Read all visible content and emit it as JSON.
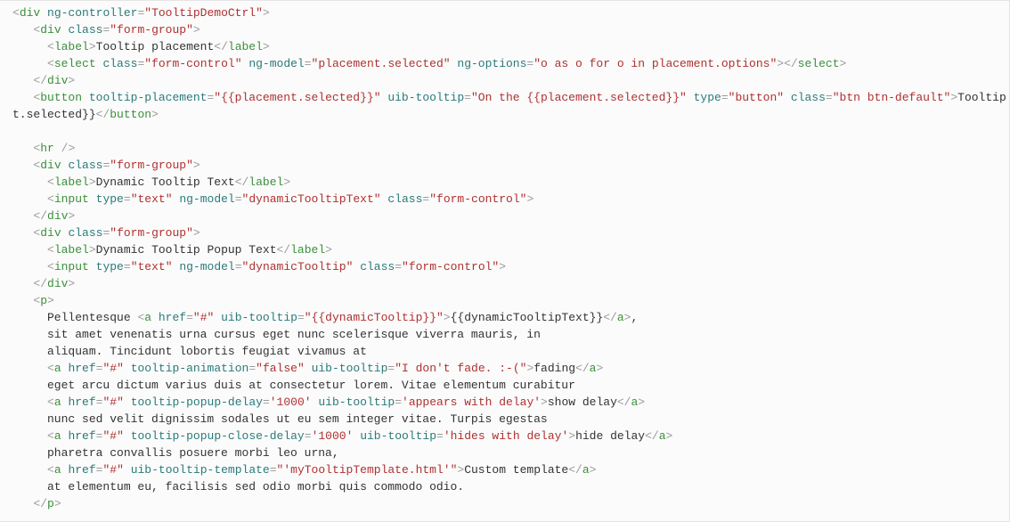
{
  "lines": [
    [
      [
        "p",
        "<"
      ],
      [
        "t",
        "div"
      ],
      [
        "x",
        " "
      ],
      [
        "a",
        "ng-controller"
      ],
      [
        "p",
        "="
      ],
      [
        "s",
        "\"TooltipDemoCtrl\""
      ],
      [
        "p",
        ">"
      ]
    ],
    [
      [
        "x",
        "   "
      ],
      [
        "p",
        "<"
      ],
      [
        "t",
        "div"
      ],
      [
        "x",
        " "
      ],
      [
        "a",
        "class"
      ],
      [
        "p",
        "="
      ],
      [
        "s",
        "\"form-group\""
      ],
      [
        "p",
        ">"
      ]
    ],
    [
      [
        "x",
        "     "
      ],
      [
        "p",
        "<"
      ],
      [
        "t",
        "label"
      ],
      [
        "p",
        ">"
      ],
      [
        "x",
        "Tooltip placement"
      ],
      [
        "p",
        "</"
      ],
      [
        "t",
        "label"
      ],
      [
        "p",
        ">"
      ]
    ],
    [
      [
        "x",
        "     "
      ],
      [
        "p",
        "<"
      ],
      [
        "t",
        "select"
      ],
      [
        "x",
        " "
      ],
      [
        "a",
        "class"
      ],
      [
        "p",
        "="
      ],
      [
        "s",
        "\"form-control\""
      ],
      [
        "x",
        " "
      ],
      [
        "a",
        "ng-model"
      ],
      [
        "p",
        "="
      ],
      [
        "s",
        "\"placement.selected\""
      ],
      [
        "x",
        " "
      ],
      [
        "a",
        "ng-options"
      ],
      [
        "p",
        "="
      ],
      [
        "s",
        "\"o as o for o in placement.options\""
      ],
      [
        "p",
        "></"
      ],
      [
        "t",
        "select"
      ],
      [
        "p",
        ">"
      ]
    ],
    [
      [
        "x",
        "   "
      ],
      [
        "p",
        "</"
      ],
      [
        "t",
        "div"
      ],
      [
        "p",
        ">"
      ]
    ],
    [
      [
        "x",
        "   "
      ],
      [
        "p",
        "<"
      ],
      [
        "t",
        "button"
      ],
      [
        "x",
        " "
      ],
      [
        "a",
        "tooltip-placement"
      ],
      [
        "p",
        "="
      ],
      [
        "s",
        "\"{{placement.selected}}\""
      ],
      [
        "x",
        " "
      ],
      [
        "a",
        "uib-tooltip"
      ],
      [
        "p",
        "="
      ],
      [
        "s",
        "\"On the {{placement.selected}}\""
      ],
      [
        "x",
        " "
      ],
      [
        "a",
        "type"
      ],
      [
        "p",
        "="
      ],
      [
        "s",
        "\"button\""
      ],
      [
        "x",
        " "
      ],
      [
        "a",
        "class"
      ],
      [
        "p",
        "="
      ],
      [
        "s",
        "\"btn btn-default\""
      ],
      [
        "p",
        ">"
      ],
      [
        "x",
        "Tooltip {{placemen"
      ]
    ],
    [
      [
        "x",
        "t.selected}}"
      ],
      [
        "p",
        "</"
      ],
      [
        "t",
        "button"
      ],
      [
        "p",
        ">"
      ]
    ],
    [
      [
        "x",
        " "
      ]
    ],
    [
      [
        "x",
        "   "
      ],
      [
        "p",
        "<"
      ],
      [
        "t",
        "hr"
      ],
      [
        "x",
        " "
      ],
      [
        "p",
        "/>"
      ]
    ],
    [
      [
        "x",
        "   "
      ],
      [
        "p",
        "<"
      ],
      [
        "t",
        "div"
      ],
      [
        "x",
        " "
      ],
      [
        "a",
        "class"
      ],
      [
        "p",
        "="
      ],
      [
        "s",
        "\"form-group\""
      ],
      [
        "p",
        ">"
      ]
    ],
    [
      [
        "x",
        "     "
      ],
      [
        "p",
        "<"
      ],
      [
        "t",
        "label"
      ],
      [
        "p",
        ">"
      ],
      [
        "x",
        "Dynamic Tooltip Text"
      ],
      [
        "p",
        "</"
      ],
      [
        "t",
        "label"
      ],
      [
        "p",
        ">"
      ]
    ],
    [
      [
        "x",
        "     "
      ],
      [
        "p",
        "<"
      ],
      [
        "t",
        "input"
      ],
      [
        "x",
        " "
      ],
      [
        "a",
        "type"
      ],
      [
        "p",
        "="
      ],
      [
        "s",
        "\"text\""
      ],
      [
        "x",
        " "
      ],
      [
        "a",
        "ng-model"
      ],
      [
        "p",
        "="
      ],
      [
        "s",
        "\"dynamicTooltipText\""
      ],
      [
        "x",
        " "
      ],
      [
        "a",
        "class"
      ],
      [
        "p",
        "="
      ],
      [
        "s",
        "\"form-control\""
      ],
      [
        "p",
        ">"
      ]
    ],
    [
      [
        "x",
        "   "
      ],
      [
        "p",
        "</"
      ],
      [
        "t",
        "div"
      ],
      [
        "p",
        ">"
      ]
    ],
    [
      [
        "x",
        "   "
      ],
      [
        "p",
        "<"
      ],
      [
        "t",
        "div"
      ],
      [
        "x",
        " "
      ],
      [
        "a",
        "class"
      ],
      [
        "p",
        "="
      ],
      [
        "s",
        "\"form-group\""
      ],
      [
        "p",
        ">"
      ]
    ],
    [
      [
        "x",
        "     "
      ],
      [
        "p",
        "<"
      ],
      [
        "t",
        "label"
      ],
      [
        "p",
        ">"
      ],
      [
        "x",
        "Dynamic Tooltip Popup Text"
      ],
      [
        "p",
        "</"
      ],
      [
        "t",
        "label"
      ],
      [
        "p",
        ">"
      ]
    ],
    [
      [
        "x",
        "     "
      ],
      [
        "p",
        "<"
      ],
      [
        "t",
        "input"
      ],
      [
        "x",
        " "
      ],
      [
        "a",
        "type"
      ],
      [
        "p",
        "="
      ],
      [
        "s",
        "\"text\""
      ],
      [
        "x",
        " "
      ],
      [
        "a",
        "ng-model"
      ],
      [
        "p",
        "="
      ],
      [
        "s",
        "\"dynamicTooltip\""
      ],
      [
        "x",
        " "
      ],
      [
        "a",
        "class"
      ],
      [
        "p",
        "="
      ],
      [
        "s",
        "\"form-control\""
      ],
      [
        "p",
        ">"
      ]
    ],
    [
      [
        "x",
        "   "
      ],
      [
        "p",
        "</"
      ],
      [
        "t",
        "div"
      ],
      [
        "p",
        ">"
      ]
    ],
    [
      [
        "x",
        "   "
      ],
      [
        "p",
        "<"
      ],
      [
        "t",
        "p"
      ],
      [
        "p",
        ">"
      ]
    ],
    [
      [
        "x",
        "     Pellentesque "
      ],
      [
        "p",
        "<"
      ],
      [
        "t",
        "a"
      ],
      [
        "x",
        " "
      ],
      [
        "a",
        "href"
      ],
      [
        "p",
        "="
      ],
      [
        "s",
        "\"#\""
      ],
      [
        "x",
        " "
      ],
      [
        "a",
        "uib-tooltip"
      ],
      [
        "p",
        "="
      ],
      [
        "s",
        "\"{{dynamicTooltip}}\""
      ],
      [
        "p",
        ">"
      ],
      [
        "x",
        "{{dynamicTooltipText}}"
      ],
      [
        "p",
        "</"
      ],
      [
        "t",
        "a"
      ],
      [
        "p",
        ">"
      ],
      [
        "x",
        ","
      ]
    ],
    [
      [
        "x",
        "     sit amet venenatis urna cursus eget nunc scelerisque viverra mauris, in"
      ]
    ],
    [
      [
        "x",
        "     aliquam. Tincidunt lobortis feugiat vivamus at"
      ]
    ],
    [
      [
        "x",
        "     "
      ],
      [
        "p",
        "<"
      ],
      [
        "t",
        "a"
      ],
      [
        "x",
        " "
      ],
      [
        "a",
        "href"
      ],
      [
        "p",
        "="
      ],
      [
        "s",
        "\"#\""
      ],
      [
        "x",
        " "
      ],
      [
        "a",
        "tooltip-animation"
      ],
      [
        "p",
        "="
      ],
      [
        "s",
        "\"false\""
      ],
      [
        "x",
        " "
      ],
      [
        "a",
        "uib-tooltip"
      ],
      [
        "p",
        "="
      ],
      [
        "s",
        "\"I don't fade. :-(\""
      ],
      [
        "p",
        ">"
      ],
      [
        "x",
        "fading"
      ],
      [
        "p",
        "</"
      ],
      [
        "t",
        "a"
      ],
      [
        "p",
        ">"
      ]
    ],
    [
      [
        "x",
        "     eget arcu dictum varius duis at consectetur lorem. Vitae elementum curabitur"
      ]
    ],
    [
      [
        "x",
        "     "
      ],
      [
        "p",
        "<"
      ],
      [
        "t",
        "a"
      ],
      [
        "x",
        " "
      ],
      [
        "a",
        "href"
      ],
      [
        "p",
        "="
      ],
      [
        "s",
        "\"#\""
      ],
      [
        "x",
        " "
      ],
      [
        "a",
        "tooltip-popup-delay"
      ],
      [
        "p",
        "="
      ],
      [
        "s",
        "'1000'"
      ],
      [
        "x",
        " "
      ],
      [
        "a",
        "uib-tooltip"
      ],
      [
        "p",
        "="
      ],
      [
        "s",
        "'appears with delay'"
      ],
      [
        "p",
        ">"
      ],
      [
        "x",
        "show delay"
      ],
      [
        "p",
        "</"
      ],
      [
        "t",
        "a"
      ],
      [
        "p",
        ">"
      ]
    ],
    [
      [
        "x",
        "     nunc sed velit dignissim sodales ut eu sem integer vitae. Turpis egestas"
      ]
    ],
    [
      [
        "x",
        "     "
      ],
      [
        "p",
        "<"
      ],
      [
        "t",
        "a"
      ],
      [
        "x",
        " "
      ],
      [
        "a",
        "href"
      ],
      [
        "p",
        "="
      ],
      [
        "s",
        "\"#\""
      ],
      [
        "x",
        " "
      ],
      [
        "a",
        "tooltip-popup-close-delay"
      ],
      [
        "p",
        "="
      ],
      [
        "s",
        "'1000'"
      ],
      [
        "x",
        " "
      ],
      [
        "a",
        "uib-tooltip"
      ],
      [
        "p",
        "="
      ],
      [
        "s",
        "'hides with delay'"
      ],
      [
        "p",
        ">"
      ],
      [
        "x",
        "hide delay"
      ],
      [
        "p",
        "</"
      ],
      [
        "t",
        "a"
      ],
      [
        "p",
        ">"
      ]
    ],
    [
      [
        "x",
        "     pharetra convallis posuere morbi leo urna,"
      ]
    ],
    [
      [
        "x",
        "     "
      ],
      [
        "p",
        "<"
      ],
      [
        "t",
        "a"
      ],
      [
        "x",
        " "
      ],
      [
        "a",
        "href"
      ],
      [
        "p",
        "="
      ],
      [
        "s",
        "\"#\""
      ],
      [
        "x",
        " "
      ],
      [
        "a",
        "uib-tooltip-template"
      ],
      [
        "p",
        "="
      ],
      [
        "s",
        "\"'myTooltipTemplate.html'\""
      ],
      [
        "p",
        ">"
      ],
      [
        "x",
        "Custom template"
      ],
      [
        "p",
        "</"
      ],
      [
        "t",
        "a"
      ],
      [
        "p",
        ">"
      ]
    ],
    [
      [
        "x",
        "     at elementum eu, facilisis sed odio morbi quis commodo odio."
      ]
    ],
    [
      [
        "x",
        "   "
      ],
      [
        "p",
        "</"
      ],
      [
        "t",
        "p"
      ],
      [
        "p",
        ">"
      ]
    ]
  ]
}
